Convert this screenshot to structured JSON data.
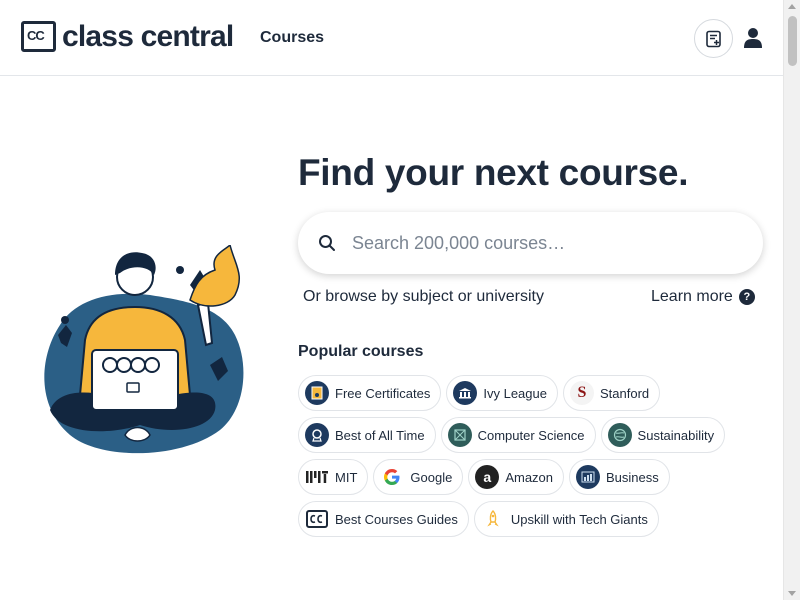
{
  "header": {
    "logo_mark": "CC",
    "logo_text": "class central",
    "nav_courses": "Courses"
  },
  "hero": {
    "title": "Find your next course.",
    "search_placeholder": "Search 200,000 courses…",
    "browse_text": "Or browse by subject or university",
    "learn_more": "Learn more",
    "help_glyph": "?"
  },
  "popular": {
    "title": "Popular courses",
    "rows": [
      [
        {
          "label": "Free Certificates",
          "icon": "certificate-icon"
        },
        {
          "label": "Ivy League",
          "icon": "university-icon"
        },
        {
          "label": "Stanford",
          "icon": "stanford-icon"
        }
      ],
      [
        {
          "label": "Best of All Time",
          "icon": "award-icon"
        },
        {
          "label": "Computer Science",
          "icon": "circuit-icon"
        },
        {
          "label": "Sustainability",
          "icon": "globe-icon"
        }
      ],
      [
        {
          "label": "MIT",
          "icon": "mit-logo-icon"
        },
        {
          "label": "Google",
          "icon": "google-logo-icon"
        },
        {
          "label": "Amazon",
          "icon": "amazon-logo-icon"
        },
        {
          "label": "Business",
          "icon": "chart-icon"
        }
      ],
      [
        {
          "label": "Best Courses Guides",
          "icon": "cc-logo-icon"
        },
        {
          "label": "Upskill with Tech Giants",
          "icon": "rocket-icon"
        }
      ]
    ]
  },
  "colors": {
    "primary_text": "#1e2a3b",
    "illustration_blue": "#2b5f86",
    "illustration_yellow": "#f6b73c"
  }
}
